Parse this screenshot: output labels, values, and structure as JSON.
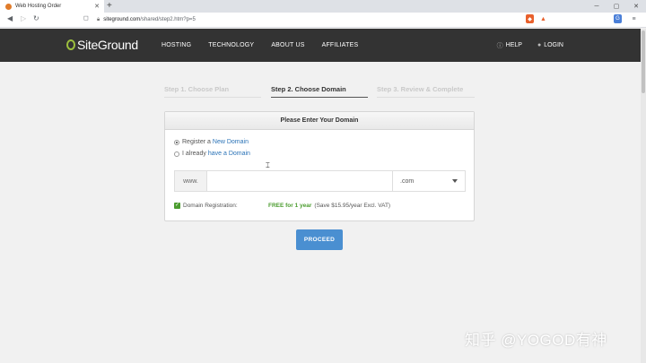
{
  "browser": {
    "tab_title": "Web Hosting Order",
    "tab_close": "✕",
    "new_tab": "+",
    "window_controls": [
      "─",
      "▢",
      "✕"
    ],
    "url_host": "siteground.com",
    "url_path": "/shared/step2.htm?p=5"
  },
  "header": {
    "logo_text": "SiteGround",
    "nav": [
      "HOSTING",
      "TECHNOLOGY",
      "ABOUT US",
      "AFFILIATES"
    ],
    "help": "HELP",
    "login": "LOGIN"
  },
  "steps": [
    {
      "label": "Step 1. Choose Plan",
      "state": "inactive"
    },
    {
      "label": "Step 2. Choose Domain",
      "state": "active"
    },
    {
      "label": "Step 3. Review & Complete",
      "state": "inactive"
    }
  ],
  "panel": {
    "title": "Please Enter Your Domain",
    "option1_prefix": "Register a",
    "option1_link": "New Domain",
    "option2_prefix": "I already",
    "option2_link": "have a Domain",
    "prefix": "www.",
    "domain_value": "",
    "tld_selected": ".com",
    "reg_label": "Domain Registration:",
    "free_text": "FREE for 1 year",
    "save_text": "(Save $15.95/year Excl. VAT)"
  },
  "proceed_label": "PROCEED",
  "watermark": "知乎 @YOGOD有神",
  "colors": {
    "header_bg": "#333333",
    "accent_green": "#4b9c2f",
    "button_blue": "#4a8fd1",
    "link_blue": "#2b73b7"
  }
}
